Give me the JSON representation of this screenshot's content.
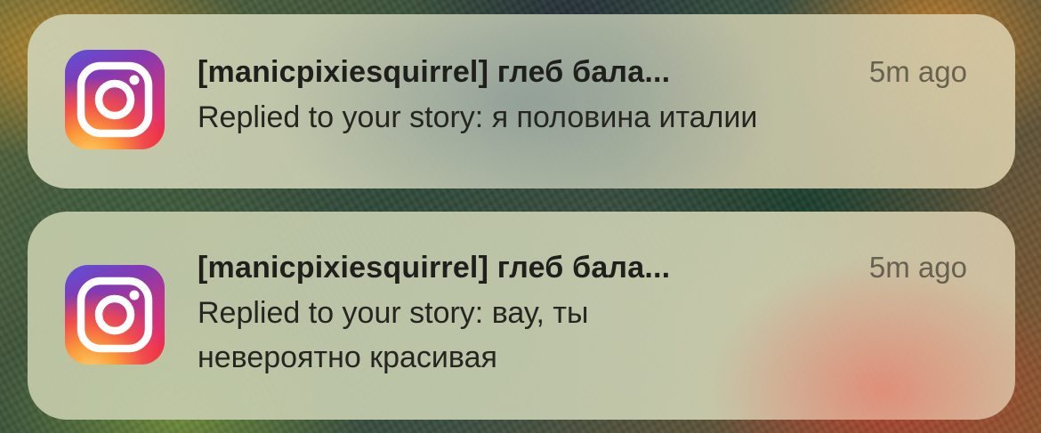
{
  "notifications": [
    {
      "app_icon": "instagram-icon",
      "sender": "[manicpixiesquirrel] глеб бала...",
      "time": "5m ago",
      "body": "Replied to your story: я половина италии"
    },
    {
      "app_icon": "instagram-icon",
      "sender": "[manicpixiesquirrel] глеб бала...",
      "time": "5m ago",
      "body_line1": "Replied to your story: вау, ты",
      "body_line2": "невероятно красивая"
    }
  ],
  "colors": {
    "notification_glass": "#c9cdb0",
    "time_text": "#6b675a",
    "instagram_gradient_start": "#5b51d8",
    "instagram_gradient_end": "#fdd56b"
  }
}
